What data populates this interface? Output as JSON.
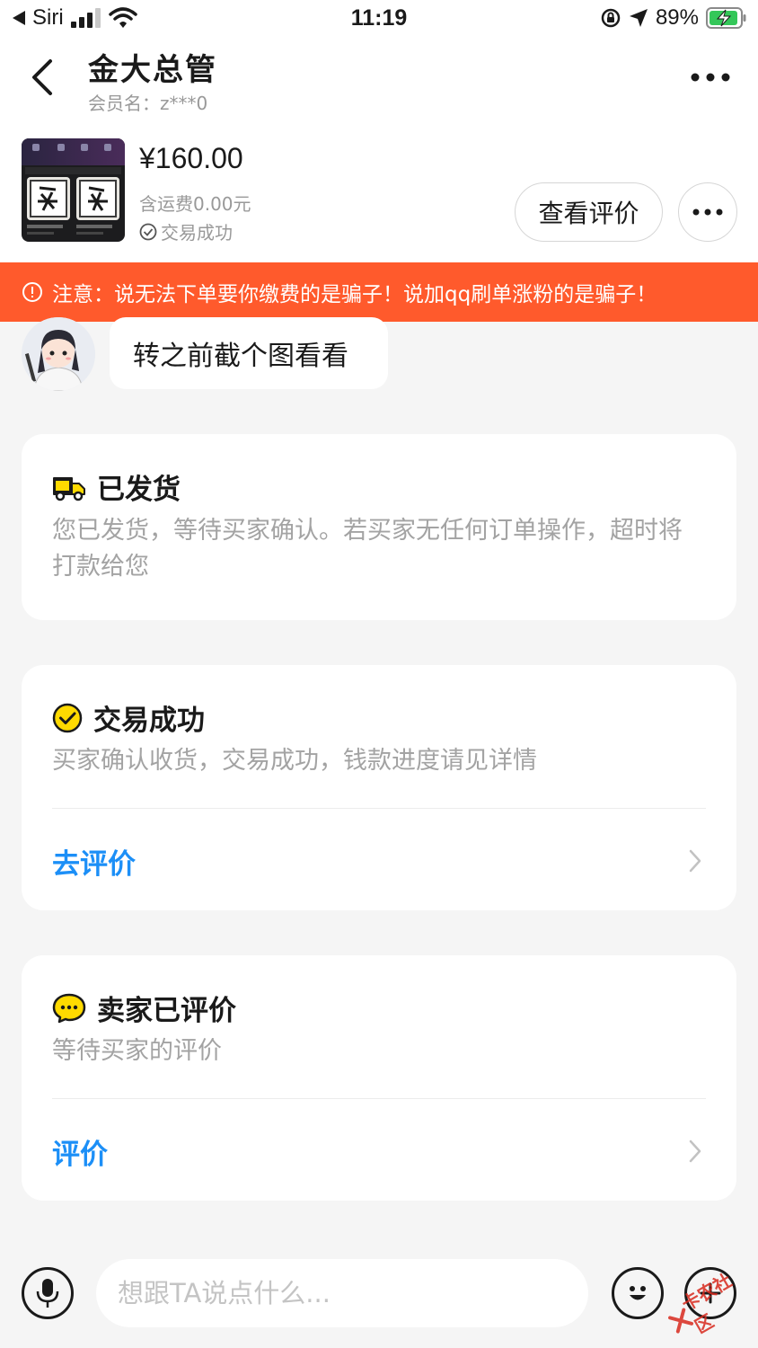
{
  "status_bar": {
    "carrier": "Siri",
    "time": "11:19",
    "battery": "89%"
  },
  "header": {
    "title": "金大总管",
    "member": "会员名：z***0"
  },
  "product": {
    "price": "¥160.00",
    "shipping": "含运费0.00元",
    "status": "交易成功",
    "view_review_label": "查看评价"
  },
  "warning": {
    "text": "注意：说无法下单要你缴费的是骗子！说加qq刷单涨粉的是骗子！"
  },
  "chat": {
    "message": "转之前截个图看看"
  },
  "cards": {
    "shipped": {
      "title": "已发货",
      "desc": "您已发货，等待买家确认。若买家无任何订单操作，超时将打款给您"
    },
    "success": {
      "title": "交易成功",
      "desc": "买家确认收货，交易成功，钱款进度请见详情",
      "link": "去评价"
    },
    "seller_reviewed": {
      "title": "卖家已评价",
      "desc": "等待买家的评价",
      "link": "评价"
    }
  },
  "input": {
    "placeholder": "想跟TA说点什么..."
  },
  "watermark": {
    "text": "卡农社区"
  },
  "colors": {
    "accent_yellow": "#ffda00",
    "warning": "#ff5a2c",
    "link_blue": "#1c8ff7"
  }
}
